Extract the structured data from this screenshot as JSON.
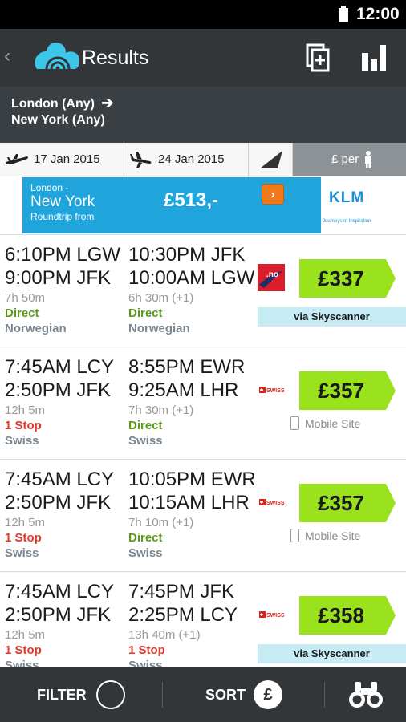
{
  "status_bar": {
    "time": "12:00"
  },
  "action_bar": {
    "back_icon": "chevron-left-icon",
    "title": "Results"
  },
  "route": {
    "from": "London (Any)",
    "to": "New York (Any)"
  },
  "dates": {
    "outbound": "17 Jan 2015",
    "inbound": "24 Jan 2015",
    "per_label": "£ per"
  },
  "ad": {
    "line1": "London -",
    "line2": "New York",
    "line3": "Roundtrip from",
    "price": "£513,-",
    "cta": "›",
    "brand": "KLM",
    "brand_sub": "Journeys of Inspiration"
  },
  "results": [
    {
      "out": {
        "dep": "6:10PM LGW",
        "arr": "9:00PM JFK",
        "dur": "7h 50m",
        "stops": "Direct",
        "airline": "Norwegian"
      },
      "ret": {
        "dep": "10:30PM JFK",
        "arr": "10:00AM LGW",
        "dur": "6h 30m (+1)",
        "stops": "Direct",
        "airline": "Norwegian"
      },
      "price": "£337",
      "source": "via Skyscanner"
    },
    {
      "out": {
        "dep": "7:45AM LCY",
        "arr": "2:50PM JFK",
        "dur": "12h 5m",
        "stops": "1 Stop",
        "airline": "Swiss"
      },
      "ret": {
        "dep": "8:55PM EWR",
        "arr": "9:25AM LHR",
        "dur": "7h 30m (+1)",
        "stops": "Direct",
        "airline": "Swiss"
      },
      "price": "£357",
      "source": "Mobile Site"
    },
    {
      "out": {
        "dep": "7:45AM LCY",
        "arr": "2:50PM JFK",
        "dur": "12h 5m",
        "stops": "1 Stop",
        "airline": "Swiss"
      },
      "ret": {
        "dep": "10:05PM EWR",
        "arr": "10:15AM LHR",
        "dur": "7h 10m (+1)",
        "stops": "Direct",
        "airline": "Swiss"
      },
      "price": "£357",
      "source": "Mobile Site"
    },
    {
      "out": {
        "dep": "7:45AM LCY",
        "arr": "2:50PM JFK",
        "dur": "12h 5m",
        "stops": "1 Stop",
        "airline": "Swiss"
      },
      "ret": {
        "dep": "7:45PM JFK",
        "arr": "2:25PM LCY",
        "dur": "13h 40m (+1)",
        "stops": "1 Stop",
        "airline": "Swiss"
      },
      "price": "£358",
      "source": "via Skyscanner"
    }
  ],
  "bottom": {
    "filter": "FILTER",
    "sort": "SORT",
    "sort_symbol": "£"
  },
  "colors": {
    "direct": "#5b9a1b",
    "stop": "#e0392b",
    "price_bg": "#9be21e",
    "accent": "#36c5e8"
  }
}
